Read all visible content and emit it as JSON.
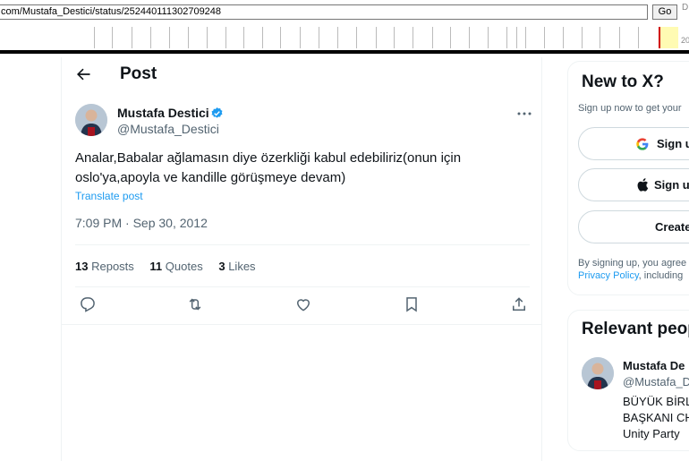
{
  "wayback": {
    "url": "com/Mustafa_Destici/status/252440111302709248",
    "go_label": "Go",
    "d_label": "D",
    "year_label": "20"
  },
  "post": {
    "header_title": "Post",
    "author_name": "Mustafa Destici",
    "author_handle": "@Mustafa_Destici",
    "text_line1": "Analar,Babalar ağlamasın diye özerkliği kabul edebiliriz(onun için",
    "text_line2": "oslo'ya,apoyla ve kandille görüşmeye devam)",
    "translate_label": "Translate post",
    "timestamp": "7:09 PM · Sep 30, 2012",
    "stats": {
      "reposts_count": "13",
      "reposts_label": "Reposts",
      "quotes_count": "11",
      "quotes_label": "Quotes",
      "likes_count": "3",
      "likes_label": "Likes"
    },
    "icons": [
      "back-arrow-icon",
      "verified-badge-icon",
      "more-icon",
      "reply-icon",
      "repost-icon",
      "like-icon",
      "bookmark-icon",
      "share-icon"
    ],
    "accent_color": "#1d9bf0"
  },
  "sidebar": {
    "new_to_x": {
      "title": "New to X?",
      "subtitle": "Sign up now to get your",
      "google_button": "Sign u",
      "apple_button": "Sign u",
      "create_button": "Create",
      "legal_line1": "By signing up, you agree",
      "legal_link": "Privacy Policy",
      "legal_line2_rest": ", including"
    },
    "relevant_people": {
      "title": "Relevant peop",
      "name": "Mustafa De",
      "handle": "@Mustafa_D",
      "bio_line1": "BÜYÜK BİRL",
      "bio_line2": "BAŞKANI CH",
      "bio_line3": "Unity Party"
    }
  }
}
